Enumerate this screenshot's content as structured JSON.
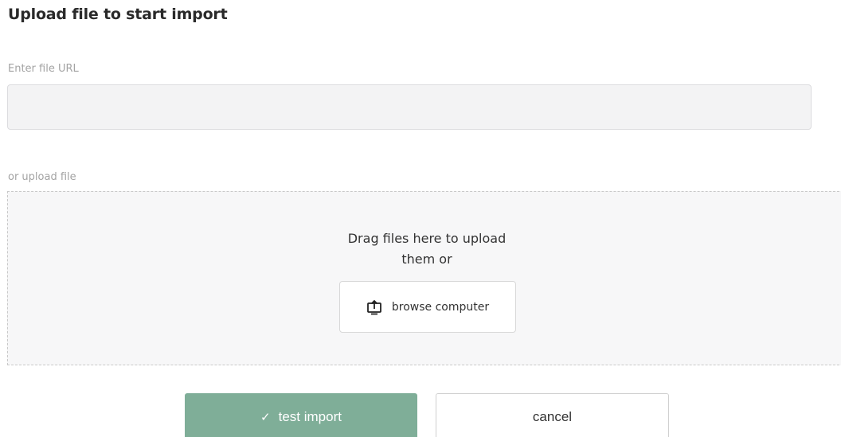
{
  "header": {
    "title": "Upload file to start import"
  },
  "url_field": {
    "label": "Enter file URL",
    "value": "",
    "placeholder": ""
  },
  "upload": {
    "label": "or upload file",
    "drop_text_line1": "Drag files here to upload",
    "drop_text_line2": "them or",
    "browse_label": "browse computer",
    "browse_icon": "upload-icon"
  },
  "actions": {
    "test_label": "test import",
    "test_icon": "check-icon",
    "cancel_label": "cancel"
  },
  "colors": {
    "primary": "#7fae98",
    "input_bg": "#f3f3f4",
    "dropzone_border": "#c9c9c9",
    "label": "#a3a3a3"
  }
}
